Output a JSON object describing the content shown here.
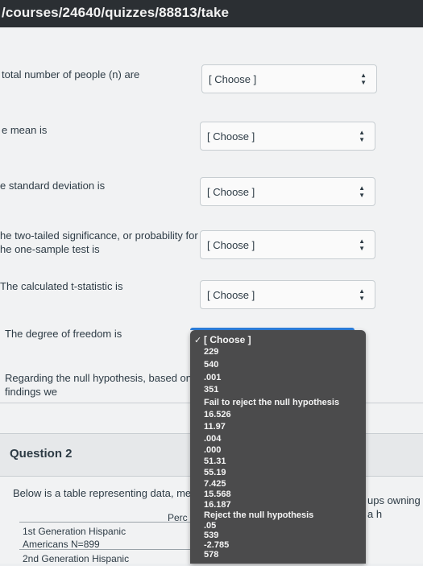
{
  "browser": {
    "url": "/courses/24640/quizzes/88813/take"
  },
  "questions": [
    {
      "label": "total number of people (n) are",
      "value": "[ Choose ]"
    },
    {
      "label": "e mean is",
      "value": "[ Choose ]"
    },
    {
      "label": "e standard deviation is",
      "value": "[ Choose ]"
    },
    {
      "label_line1": "he two-tailed significance, or probability for",
      "label_line2": "he one-sample test is",
      "value": "[ Choose ]"
    },
    {
      "label": "The calculated t-statistic is",
      "value": "[ Choose ]"
    },
    {
      "label": "The degree of freedom is"
    },
    {
      "label_line1": "Regarding the null hypothesis, based on thes",
      "label_line2": "findings we"
    }
  ],
  "question2": {
    "title": "Question 2",
    "prompt": "Below is a table representing data, mea",
    "prompt_right": "ups owning a h",
    "table": {
      "header_partial": "Perc",
      "rows": [
        {
          "line1": "1st Generation Hispanic",
          "line2": "Americans N=899"
        },
        {
          "line1": "2nd Generation Hispanic"
        }
      ]
    }
  },
  "dropdown": {
    "selected_mark": "✓",
    "options": [
      "[ Choose ]",
      "229",
      "540",
      ".001",
      "351",
      "Fail to reject the null hypothesis",
      "16.526",
      "11.97",
      ".004",
      ".000",
      "51.31",
      "55.19",
      "7.425",
      "15.568",
      "16.187",
      "Reject the null hypothesis",
      ".05",
      "539",
      "-2.785",
      "578"
    ]
  },
  "icons": {
    "select_arrows": "updown-arrows-icon",
    "check": "checkmark-icon"
  }
}
